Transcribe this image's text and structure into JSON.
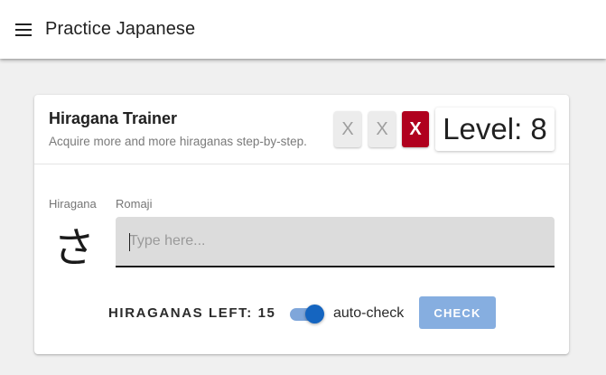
{
  "app_bar": {
    "menu_icon": "menu-icon",
    "title": "Practice Japanese"
  },
  "trainer": {
    "title": "Hiragana Trainer",
    "subtitle": "Acquire more and more hiraganas step-by-step.",
    "mistakes": [
      {
        "label": "X",
        "state": "inactive"
      },
      {
        "label": "X",
        "state": "inactive"
      },
      {
        "label": "X",
        "state": "active"
      }
    ],
    "level_text": "Level: 8",
    "hiragana_label": "Hiragana",
    "current_kana": "さ",
    "romaji_label": "Romaji",
    "romaji_input": {
      "value": "",
      "placeholder": "Type here..."
    },
    "remaining_text": "HIRAGANAS LEFT: 15",
    "auto_check": {
      "label": "auto-check",
      "enabled": true
    },
    "check_label": "CHECK"
  },
  "colors": {
    "accent": "#1565c0",
    "accent_light": "#86aee0",
    "mistake_active": "#b0001e",
    "mistake_inactive": "#ececec"
  }
}
